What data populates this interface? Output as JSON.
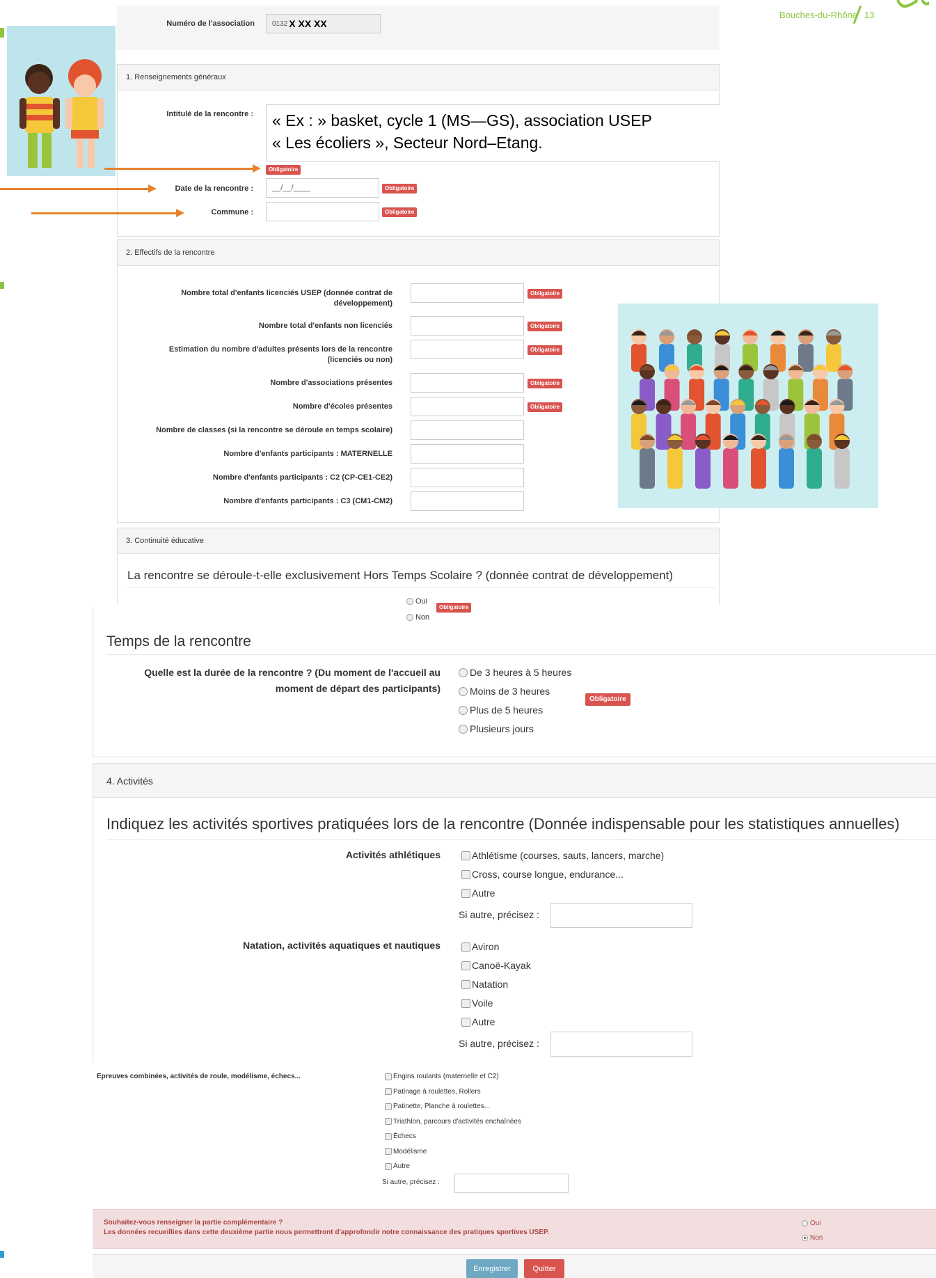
{
  "brand": {
    "region": "Bouches-du-Rhône",
    "department": "13",
    "accent": "#5cb85c",
    "region_color": "#8cc63f"
  },
  "association": {
    "label": "Numéro de l'association",
    "value": "0132",
    "masked": "X XX XX"
  },
  "section1": {
    "title": "1. Renseignements généraux",
    "intitule_label": "Intitulé de la rencontre :",
    "intitule_value_line1": "« Ex : » basket, cycle 1 (MS—GS), association USEP",
    "intitule_value_line2": "« Les écoliers », Secteur Nord–Etang.",
    "date_label": "Date de la rencontre :",
    "date_value": "__/__/____",
    "commune_label": "Commune :"
  },
  "required_label": "Obligatoire",
  "section2": {
    "title": "2. Effectifs de la rencontre",
    "rows": [
      {
        "label1": "Nombre total d'enfants licenciés USEP (donnée contrat de",
        "label2": "développement)"
      },
      {
        "label1": "Nombre total d'enfants non licenciés",
        "label2": ""
      },
      {
        "label1": "Estimation du nombre d'adultes présents lors de la rencontre",
        "label2": "(licenciés ou non)"
      },
      {
        "label1": "Nombre d'associations présentes",
        "label2": ""
      },
      {
        "label1": "Nombre d'écoles présentes",
        "label2": ""
      },
      {
        "label1": "Nombre de classes (si la rencontre se déroule en temps scolaire)",
        "label2": ""
      },
      {
        "label1": "Nombre d'enfants participants : MATERNELLE",
        "label2": ""
      },
      {
        "label1": "Nombre d'enfants participants : C2 (CP-CE1-CE2)",
        "label2": ""
      },
      {
        "label1": "Nombre d'enfants participants : C3 (CM1-CM2)",
        "label2": ""
      }
    ]
  },
  "section3": {
    "title": "3. Continuité éducative",
    "question": "La rencontre se déroule-t-elle exclusivement Hors Temps Scolaire ? (donnée contrat de développement)",
    "oui": "Oui",
    "non": "Non"
  },
  "temps": {
    "title": "Temps de la rencontre",
    "question1": "Quelle est la durée de la rencontre ? (Du moment de l'accueil au",
    "question2": "moment de départ des participants)",
    "options": [
      "De 3 heures à 5 heures",
      "Moins de 3 heures",
      "Plus de 5 heures",
      "Plusieurs jours"
    ]
  },
  "section4": {
    "title": "4. Activités",
    "intro": "Indiquez les activités sportives pratiquées lors de la rencontre (Donnée indispensable pour les statistiques annuelles)",
    "athletiques_label": "Activités athlétiques",
    "athletiques": [
      "Athlétisme (courses, sauts, lancers, marche)",
      "Cross, course longue, endurance...",
      "Autre"
    ],
    "si_autre": "Si autre, précisez :",
    "natation_label": "Natation, activités aquatiques et nautiques",
    "natation": [
      "Aviron",
      "Canoë-Kayak",
      "Natation",
      "Voile",
      "Autre"
    ],
    "epreuves_label": "Epreuves combinées, activités de roule, modélisme, échecs...",
    "epreuves": [
      "Engins roulants (maternelle et C2)",
      "Patinage à roulettes, Rollers",
      "Patinette, Planche à roulettes...",
      "Triathlon, parcours d'activités enchaînées",
      "Échecs",
      "Modélisme",
      "Autre"
    ]
  },
  "complementary": {
    "line1": "Souhaitez-vous renseigner la partie complémentaire ?",
    "line2": "Les données recueillies dans cette deuxième partie nous permettront d'approfondir notre connaissance des pratiques sportives USEP.",
    "oui": "Oui",
    "non": "Non",
    "selected": "Non"
  },
  "buttons": {
    "save": "Enregistrer",
    "quit": "Quitter"
  }
}
